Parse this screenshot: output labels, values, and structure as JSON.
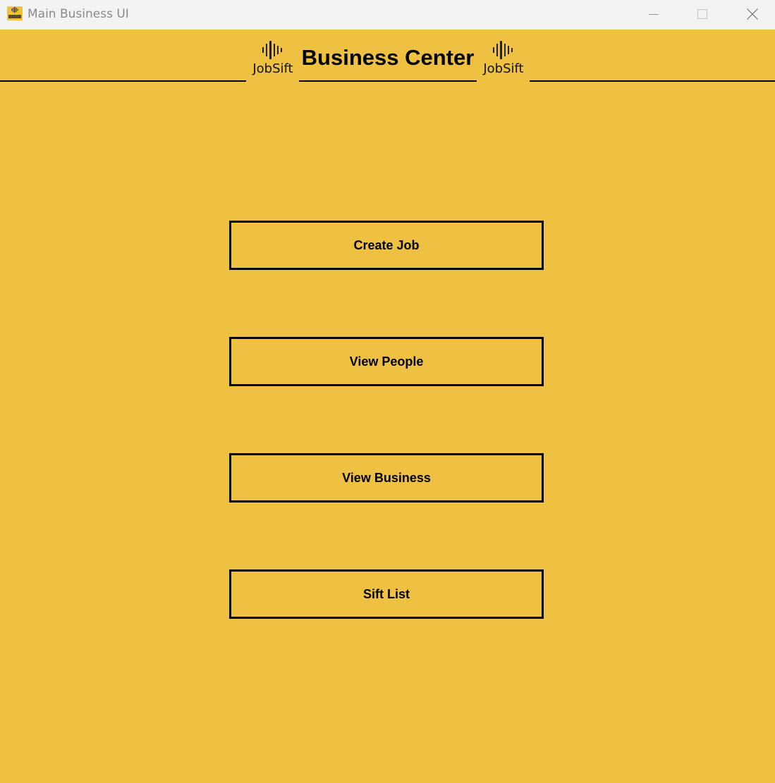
{
  "window": {
    "title": "Main Business UI",
    "app_icon": "jobsift-logo-icon",
    "controls": {
      "minimize_icon": "minimize-icon",
      "maximize_icon": "maximize-icon",
      "close_icon": "close-icon"
    }
  },
  "header": {
    "title": "Business Center",
    "logo_left": {
      "icon": "sound-wave-icon",
      "text": "JobSift"
    },
    "logo_right": {
      "icon": "sound-wave-icon",
      "text": "JobSift"
    }
  },
  "menu": {
    "buttons": [
      {
        "label": "Create Job"
      },
      {
        "label": "View People"
      },
      {
        "label": "View Business"
      },
      {
        "label": "Sift List"
      }
    ]
  },
  "colors": {
    "background": "#efc142",
    "titlebar": "#f3f3f3",
    "text": "#000000",
    "border": "#000000"
  }
}
